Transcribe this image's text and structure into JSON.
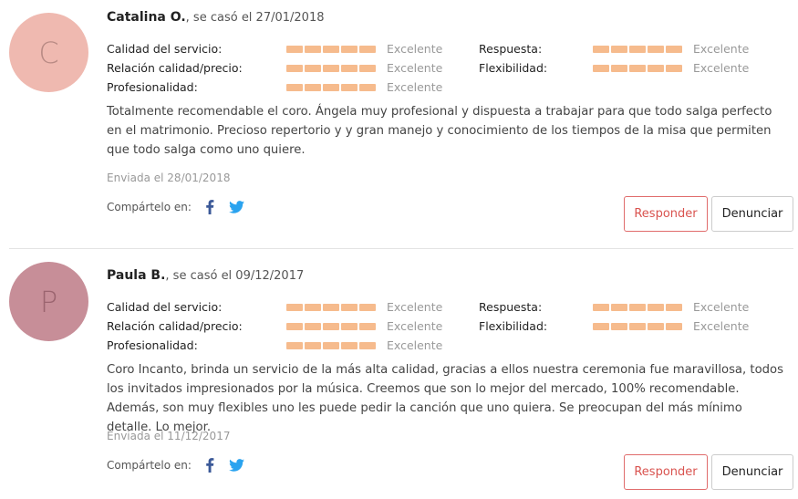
{
  "reviews": [
    {
      "initial": "C",
      "avatar_color": "#efb9b0",
      "author": "Catalina O.",
      "married_text": ", se casó el 27/01/2018",
      "ratings": {
        "calidad_servicio": {
          "label": "Calidad del servicio:",
          "value": "Excelente"
        },
        "respuesta": {
          "label": "Respuesta:",
          "value": "Excelente"
        },
        "relacion_calidad_precio": {
          "label": "Relación calidad/precio:",
          "value": "Excelente"
        },
        "flexibilidad": {
          "label": "Flexibilidad:",
          "value": "Excelente"
        },
        "profesionalidad": {
          "label": "Profesionalidad:",
          "value": "Excelente"
        }
      },
      "text": "Totalmente recomendable el coro. Ángela muy profesional y dispuesta a trabajar para que todo salga perfecto en el matrimonio. Precioso repertorio y y gran manejo y conocimiento de los tiempos de la misa que permiten que todo salga como uno quiere.",
      "sent": "Enviada el 28/01/2018",
      "share_label": "Compártelo en:",
      "reply_label": "Responder",
      "report_label": "Denunciar"
    },
    {
      "initial": "P",
      "avatar_color": "#c78e98",
      "author": "Paula B.",
      "married_text": ", se casó el 09/12/2017",
      "ratings": {
        "calidad_servicio": {
          "label": "Calidad del servicio:",
          "value": "Excelente"
        },
        "respuesta": {
          "label": "Respuesta:",
          "value": "Excelente"
        },
        "relacion_calidad_precio": {
          "label": "Relación calidad/precio:",
          "value": "Excelente"
        },
        "flexibilidad": {
          "label": "Flexibilidad:",
          "value": "Excelente"
        },
        "profesionalidad": {
          "label": "Profesionalidad:",
          "value": "Excelente"
        }
      },
      "text": "Coro Incanto, brinda un servicio de la más alta calidad, gracias a ellos nuestra ceremonia fue maravillosa, todos los invitados impresionados por la música. Creemos que son lo mejor del mercado, 100% recomendable. Además, son muy flexibles uno les puede pedir la canción que uno quiera. Se preocupan del más mínimo detalle. Lo mejor.",
      "sent": "Enviada el 11/12/2017",
      "share_label": "Compártelo en:",
      "reply_label": "Responder",
      "report_label": "Denunciar"
    }
  ],
  "colors": {
    "rating_bar": "#f6bb8d",
    "reply_border": "#e06c6c",
    "facebook": "#3b5998",
    "twitter": "#1da1f2"
  },
  "icons": [
    "facebook-icon",
    "twitter-icon"
  ]
}
